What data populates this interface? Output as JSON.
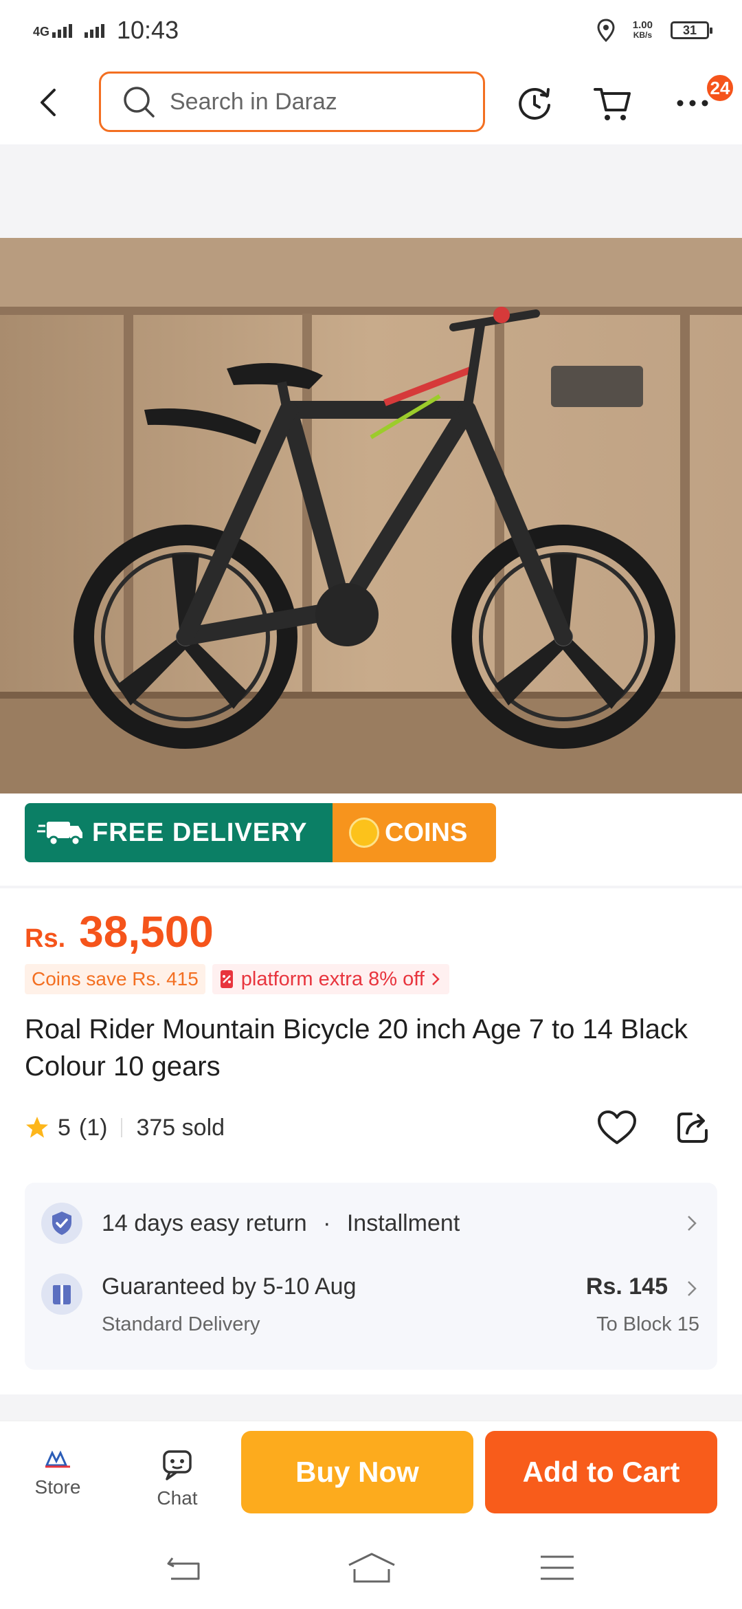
{
  "status_bar": {
    "network": "4G",
    "time": "10:43",
    "speed_value": "1.00",
    "speed_unit": "KB/s",
    "battery": "31"
  },
  "header": {
    "search_placeholder": "Search in Daraz",
    "badge_count": "24"
  },
  "promo": {
    "free_delivery": "FREE DELIVERY",
    "coins": "COINS"
  },
  "product": {
    "currency": "Rs.",
    "price": "38,500",
    "coins_save": "Coins save Rs. 415",
    "platform_offer": "platform extra 8% off",
    "title": "Roal Rider Mountain Bicycle 20 inch Age 7 to 14 Black Colour 10 gears",
    "rating": "5",
    "rating_count": "(1)",
    "sold": "375 sold"
  },
  "info": {
    "return": "14 days easy return",
    "installment": "Installment",
    "delivery_title": "Guaranteed by 5-10 Aug",
    "delivery_type": "Standard Delivery",
    "delivery_fee": "Rs. 145",
    "delivery_to": "To Block 15"
  },
  "bottom_bar": {
    "store": "Store",
    "chat": "Chat",
    "buy_now": "Buy Now",
    "add_to_cart": "Add to Cart"
  },
  "colors": {
    "accent": "#f5541b",
    "buy_now": "#fdab1d",
    "add_to_cart": "#f85c1b",
    "free_delivery": "#0b7f65",
    "coins": "#f7941d"
  }
}
